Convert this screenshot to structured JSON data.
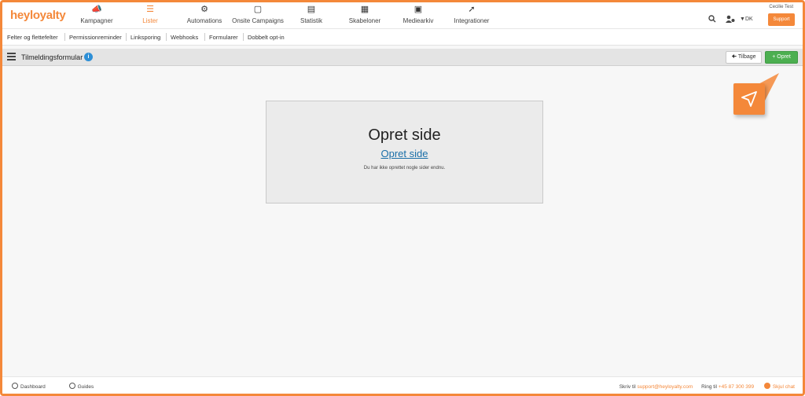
{
  "app": {
    "logo": "heyloyalty",
    "user_name": "Cecilie Test",
    "language": "DK",
    "support_label": "Support"
  },
  "nav": {
    "items": [
      {
        "label": "Kampagner",
        "icon": "megaphone-icon"
      },
      {
        "label": "Lister",
        "icon": "list-icon",
        "active": true
      },
      {
        "label": "Automations",
        "icon": "gears-icon"
      },
      {
        "label": "Onsite Campaigns",
        "icon": "window-icon"
      },
      {
        "label": "Statistik",
        "icon": "chart-icon"
      },
      {
        "label": "Skabeloner",
        "icon": "template-icon"
      },
      {
        "label": "Mediearkiv",
        "icon": "image-icon"
      },
      {
        "label": "Integrationer",
        "icon": "plug-icon"
      }
    ]
  },
  "subnav": {
    "items": [
      "Felter og flettefelter",
      "Permissionreminder",
      "Linksporing",
      "Webhooks",
      "Formularer",
      "Dobbelt opt-in"
    ]
  },
  "toolbar": {
    "title": "Tilmeldingsformular",
    "back_label": "Tilbage",
    "create_label": "Opret"
  },
  "empty_state": {
    "heading": "Opret side",
    "link": "Opret side",
    "message": "Du har ikke oprettet nogle sider endnu."
  },
  "footer": {
    "dashboard": "Dashboard",
    "guides": "Guides",
    "write_prefix": "Skriv til",
    "email": "support@heyloyalty.com",
    "call_prefix": "Ring til",
    "phone": "+45 87 300 399",
    "hide_chat": "Skjul chat"
  },
  "colors": {
    "brand": "#f4883a",
    "create_button": "#4caf50",
    "info": "#2d8fd6"
  }
}
